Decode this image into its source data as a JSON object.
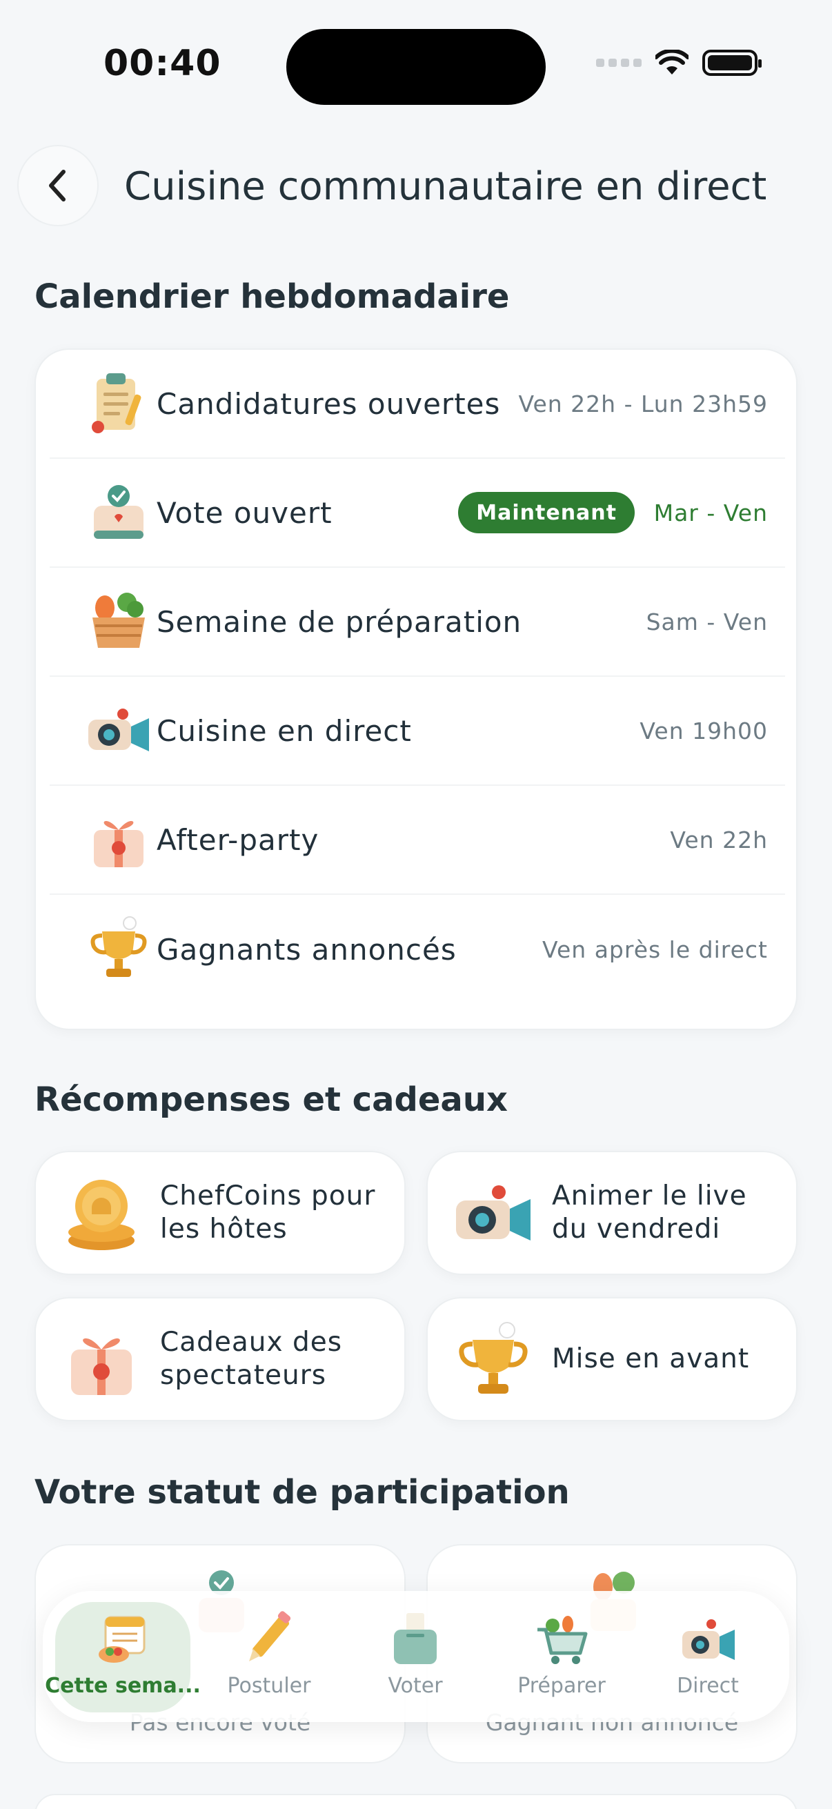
{
  "status_bar": {
    "time": "00:40"
  },
  "header": {
    "title": "Cuisine communautaire en direct",
    "back_icon": "chevron-left-icon"
  },
  "schedule": {
    "title": "Calendrier hebdomadaire",
    "rows": [
      {
        "label": "Candidatures ouvertes",
        "when": "Ven 22h - Lun 23h59",
        "icon": "clipboard-icon"
      },
      {
        "label": "Vote ouvert",
        "when": "Mar - Ven",
        "badge": "Maintenant",
        "icon": "ballot-box-icon"
      },
      {
        "label": "Semaine de préparation",
        "when": "Sam - Ven",
        "icon": "vegetable-basket-icon"
      },
      {
        "label": "Cuisine en direct",
        "when": "Ven 19h00",
        "icon": "camera-icon"
      },
      {
        "label": "After-party",
        "when": "Ven 22h",
        "icon": "gift-icon"
      },
      {
        "label": "Gagnants annoncés",
        "when": "Ven après le direct",
        "icon": "trophy-icon"
      }
    ]
  },
  "rewards": {
    "title": "Récompenses et cadeaux",
    "items": [
      {
        "label": "ChefCoins pour les hôtes",
        "icon": "coins-icon"
      },
      {
        "label": "Animer le live du vendredi",
        "icon": "camera-icon"
      },
      {
        "label": "Cadeaux des spectateurs",
        "icon": "gift-icon"
      },
      {
        "label": "Mise en avant",
        "icon": "trophy-icon"
      }
    ]
  },
  "participation": {
    "title": "Votre statut de participation",
    "cards": [
      {
        "sub": "Pas encore voté",
        "icon": "ballot-box-icon"
      },
      {
        "sub": "Gagnant non annoncé",
        "icon": "vegetable-basket-icon"
      }
    ]
  },
  "tabbar": {
    "tabs": [
      {
        "label": "Cette sema...",
        "icon": "calendar-icon",
        "active": true
      },
      {
        "label": "Postuler",
        "icon": "pencil-icon"
      },
      {
        "label": "Voter",
        "icon": "ballot-box-icon"
      },
      {
        "label": "Préparer",
        "icon": "shopping-cart-icon"
      },
      {
        "label": "Direct",
        "icon": "camera-icon"
      }
    ]
  },
  "colors": {
    "accent": "#2e7d32",
    "background": "#f5f7f9",
    "muted": "#6c7a83"
  }
}
